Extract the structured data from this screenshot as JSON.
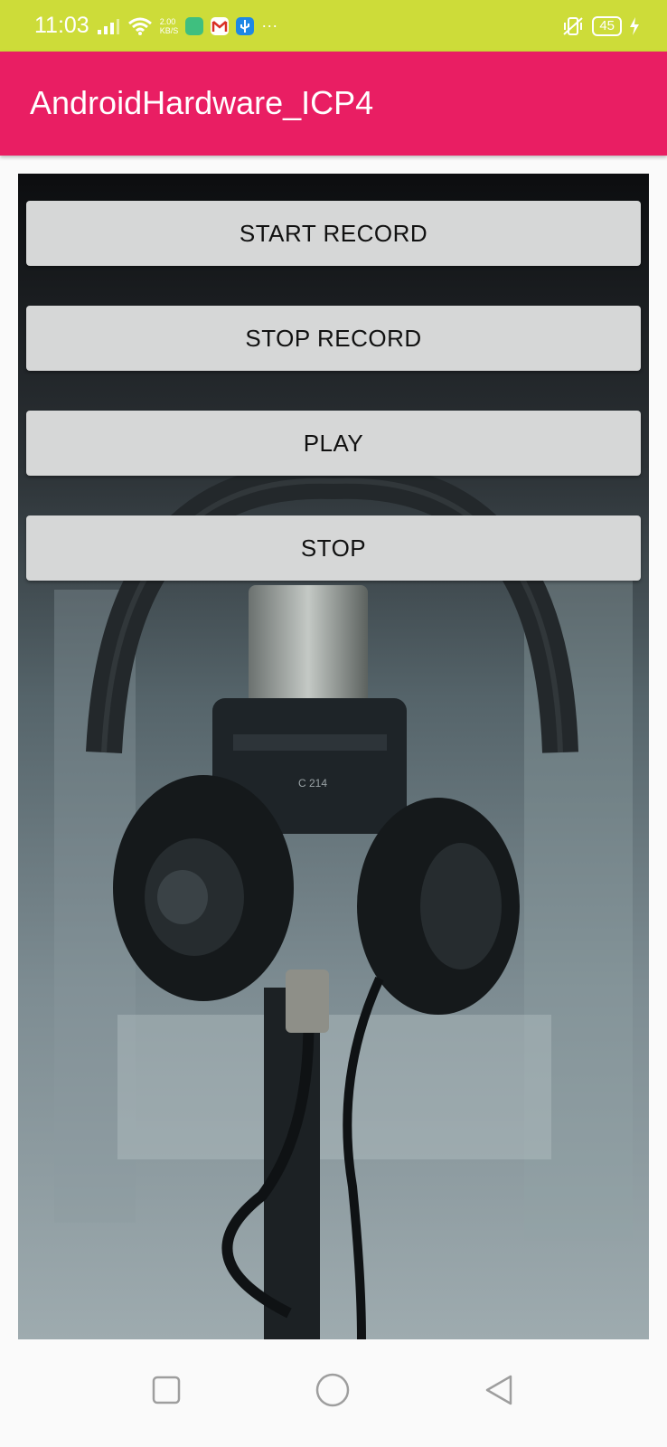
{
  "status_bar": {
    "time": "11:03",
    "net_speed_value": "2.00",
    "net_speed_unit": "KB/S",
    "battery": "45",
    "more": "···",
    "icons": [
      "signal-icon",
      "wifi-icon",
      "app-notification-icon",
      "gmail-icon",
      "usb-icon",
      "vibrate-icon",
      "battery-icon",
      "charging-icon"
    ],
    "color": "#cddc39"
  },
  "app_bar": {
    "title": "AndroidHardware_ICP4",
    "color": "#e91e63"
  },
  "main": {
    "background_image": "headphones-microphone-photo",
    "buttons": [
      {
        "label": "START RECORD"
      },
      {
        "label": "STOP RECORD"
      },
      {
        "label": "PLAY"
      },
      {
        "label": "STOP"
      }
    ]
  },
  "nav_bar": {
    "icons": [
      "recents-icon",
      "home-icon",
      "back-icon"
    ]
  }
}
